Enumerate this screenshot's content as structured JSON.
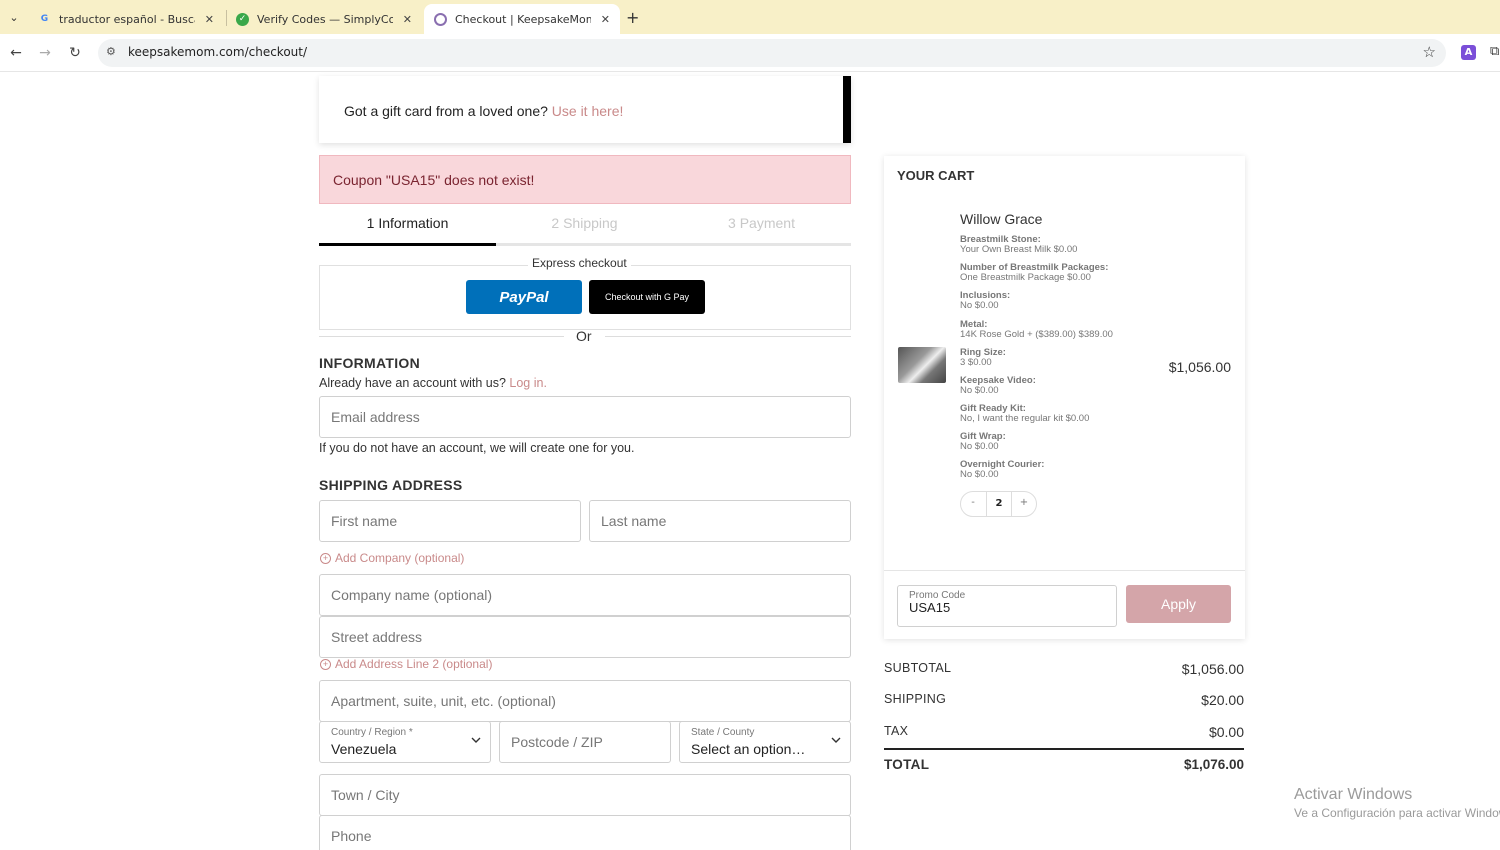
{
  "browser": {
    "tabs": [
      {
        "title": "traductor español - Buscar con",
        "favicon": "google-icon",
        "active": false
      },
      {
        "title": "Verify Codes — SimplyCodes",
        "favicon": "simplycodes-icon",
        "active": false
      },
      {
        "title": "Checkout | KeepsakeMom",
        "favicon": "keepsakemom-icon",
        "active": true
      }
    ],
    "url": "keepsakemom.com/checkout/",
    "extension_label": "A"
  },
  "gift_card": {
    "text": "Got a gift card from a loved one?",
    "link": "Use it here!"
  },
  "alert": {
    "text": "Coupon \"USA15\" does not exist!"
  },
  "steps": [
    {
      "label": "1  Information",
      "active": true
    },
    {
      "label": "2  Shipping",
      "active": false
    },
    {
      "label": "3  Payment",
      "active": false
    }
  ],
  "express": {
    "label": "Express checkout",
    "paypal_label": "PayPal",
    "gpay_label": "Checkout with G Pay",
    "or_label": "Or"
  },
  "information": {
    "heading": "INFORMATION",
    "account_text": "Already have an account with us?",
    "login_link": "Log in.",
    "email_placeholder": "Email address",
    "create_note": "If you do not have an account, we will create one for you."
  },
  "shipping": {
    "heading": "SHIPPING ADDRESS",
    "first_name_placeholder": "First name",
    "last_name_placeholder": "Last name",
    "add_company": "Add Company (optional)",
    "company_placeholder": "Company name (optional)",
    "street_placeholder": "Street address",
    "add_line2": "Add Address Line 2 (optional)",
    "apartment_placeholder": "Apartment, suite, unit, etc. (optional)",
    "country_label": "Country / Region *",
    "country_value": "Venezuela",
    "postcode_placeholder": "Postcode / ZIP",
    "state_label": "State / County",
    "state_value": "Select an option…",
    "town_placeholder": "Town / City",
    "phone_placeholder": "Phone"
  },
  "cart": {
    "title": "YOUR CART",
    "product_name": "Willow Grace",
    "product_price": "$1,056.00",
    "options": [
      {
        "key": "Breastmilk Stone:",
        "value": "Your Own Breast Milk $0.00"
      },
      {
        "key": "Number of Breastmilk Packages:",
        "value": "One Breastmilk Package $0.00"
      },
      {
        "key": "Inclusions:",
        "value": "No $0.00"
      },
      {
        "key": "Metal:",
        "value": "14K Rose Gold + ($389.00) $389.00"
      },
      {
        "key": "Ring Size:",
        "value": "3 $0.00"
      },
      {
        "key": "Keepsake Video:",
        "value": "No $0.00"
      },
      {
        "key": "Gift Ready Kit:",
        "value": "No, I want the regular kit $0.00"
      },
      {
        "key": "Gift Wrap:",
        "value": "No $0.00"
      },
      {
        "key": "Overnight Courier:",
        "value": "No $0.00"
      }
    ],
    "quantity": "2",
    "qty_minus": "-",
    "qty_plus": "+",
    "promo_label": "Promo Code",
    "promo_value": "USA15",
    "apply_label": "Apply"
  },
  "totals": {
    "subtotal_label": "SUBTOTAL",
    "subtotal_value": "$1,056.00",
    "shipping_label": "SHIPPING",
    "shipping_value": "$20.00",
    "tax_label": "TAX",
    "tax_value": "$0.00",
    "total_label": "TOTAL",
    "total_value": "$1,076.00"
  },
  "watermark": {
    "line1": "Activar Windows",
    "line2": "Ve a Configuración para activar Windows."
  },
  "colors": {
    "accent_link": "#c98a8a",
    "alert_bg": "#f9d7db",
    "apply_bg": "#d4a5a9",
    "paypal_blue": "#0070ba",
    "tabbar_bg": "#f8f0c8"
  }
}
